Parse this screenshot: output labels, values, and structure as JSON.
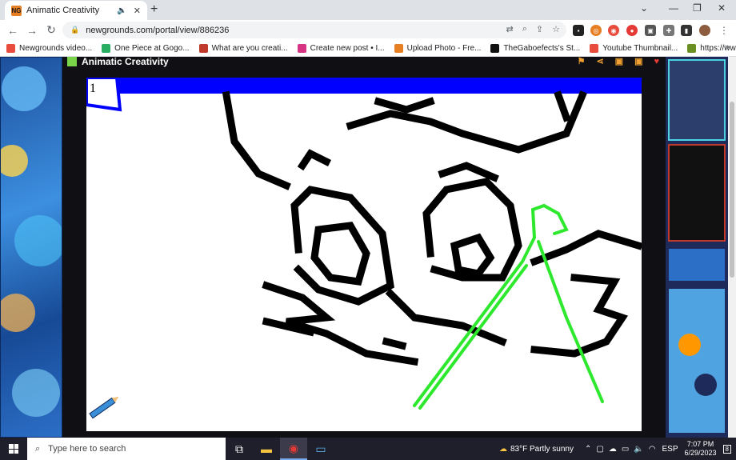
{
  "tab": {
    "title": "Animatic Creativity",
    "favicon_text": "NG"
  },
  "toolbar": {
    "url": "newgrounds.com/portal/view/886236"
  },
  "bookmarks": [
    {
      "label": "Newgrounds video...",
      "color": "#e74c3c"
    },
    {
      "label": "One Piece at Gogo...",
      "color": "#27ae60"
    },
    {
      "label": "What are you creati...",
      "color": "#c0392b"
    },
    {
      "label": "Create new post • I...",
      "color": "#d63384"
    },
    {
      "label": "Upload Photo - Fre...",
      "color": "#e67e22"
    },
    {
      "label": "TheGaboefects's St...",
      "color": "#111111"
    },
    {
      "label": "Youtube Thumbnail...",
      "color": "#e74c3c"
    },
    {
      "label": "https://www.realiza...",
      "color": "#6b8e23"
    }
  ],
  "panel": {
    "title": "Animatic Creativity",
    "frame_number": "1"
  },
  "taskbar": {
    "search_placeholder": "Type here to search",
    "weather": "83°F  Partly sunny",
    "language": "ESP",
    "time": "7:07 PM",
    "date": "6/29/2023",
    "notification_count": "8"
  },
  "colors": {
    "accent_blue": "#0000ff",
    "line_green": "#2ee82e",
    "ink": "#000000"
  }
}
